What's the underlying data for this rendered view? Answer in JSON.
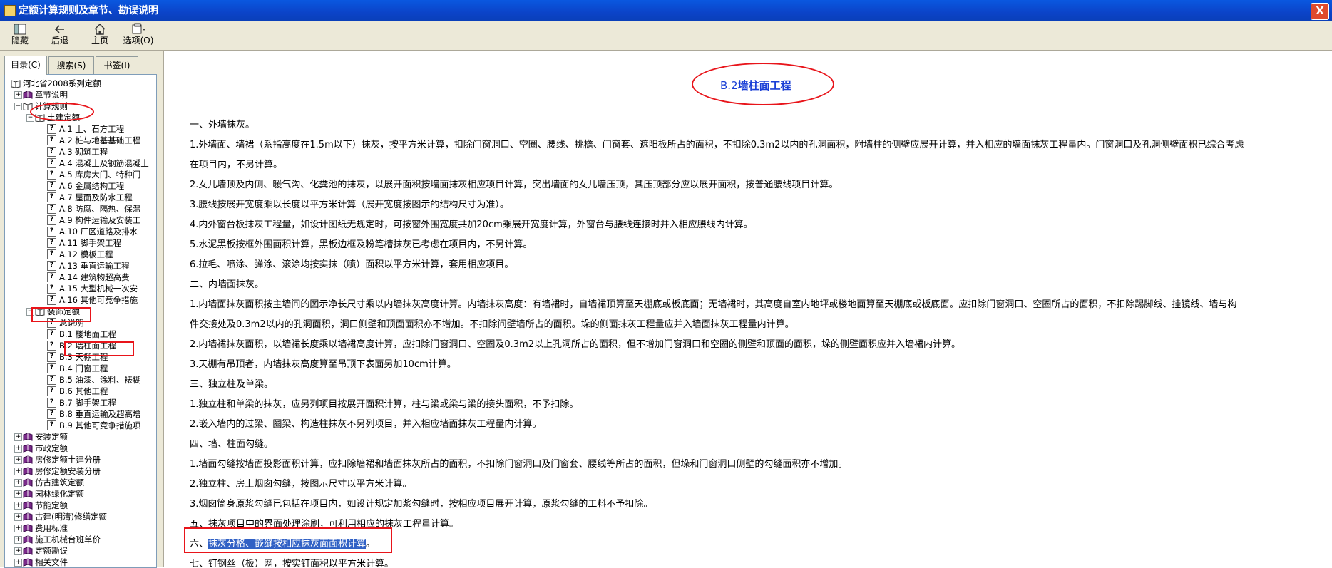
{
  "window": {
    "title": "定额计算规则及章节、勘误说明",
    "close_label": "X"
  },
  "toolbar": {
    "buttons": [
      {
        "label": "隐藏",
        "icon": "hide-icon"
      },
      {
        "label": "后退",
        "icon": "back-arrow-icon"
      },
      {
        "label": "主页",
        "icon": "home-icon"
      },
      {
        "label": "选项(O)",
        "icon": "options-icon"
      }
    ]
  },
  "tabs": [
    {
      "label": "目录(C)"
    },
    {
      "label": "搜索(S)"
    },
    {
      "label": "书签(I)"
    }
  ],
  "tree": [
    "河北省2008系列定额",
    "章节说明",
    "计算规则",
    "土建定额",
    "A.1 土、石方工程",
    "A.2 桩与地基基础工程",
    "A.3 砌筑工程",
    "A.4 混凝土及钢筋混凝土",
    "A.5 库房大门、特种门",
    "A.6 金属结构工程",
    "A.7 屋面及防水工程",
    "A.8 防腐、隔热、保温",
    "A.9 构件运输及安装工",
    "A.10 厂区道路及排水",
    "A.11 脚手架工程",
    "A.12 模板工程",
    "A.13 垂直运输工程",
    "A.14 建筑物超高费",
    "A.15 大型机械一次安",
    "A.16 其他可竞争措施",
    "装饰定额",
    "总说明",
    "B.1 楼地面工程",
    "B.2 墙柱面工程",
    "B.3 天棚工程",
    "B.4 门窗工程",
    "B.5 油漆、涂料、裱糊",
    "B.6 其他工程",
    "B.7 脚手架工程",
    "B.8 垂直运输及超高增",
    "B.9 其他可竞争措施项",
    "安装定额",
    "市政定额",
    "房修定额土建分册",
    "房修定额安装分册",
    "仿古建筑定额",
    "园林绿化定额",
    "节能定额",
    "古建(明清)修缮定额",
    "费用标准",
    "施工机械台班单价",
    "定额勘误",
    "相关文件"
  ],
  "content": {
    "heading": "B.2墙柱面工程",
    "heading_prefix": "B.2",
    "heading_suffix": "墙柱面工程",
    "paragraphs": [
      "一、外墙抹灰。",
      "1.外墙面、墙裙（系指高度在1.5m以下）抹灰，按平方米计算，扣除门窗洞口、空圈、腰线、挑檐、门窗套、遮阳板所占的面积，不扣除0.3m2以内的孔洞面积，附墙柱的侧壁应展开计算，并入相应的墙面抹灰工程量内。门窗洞口及孔洞侧壁面积已综合考虑",
      "在项目内，不另计算。",
      "2.女儿墙顶及内侧、暖气沟、化粪池的抹灰，以展开面积按墙面抹灰相应项目计算，突出墙面的女儿墙压顶，其压顶部分应以展开面积，按普通腰线项目计算。",
      "3.腰线按展开宽度乘以长度以平方米计算（展开宽度按图示的结构尺寸为准）。",
      "4.内外窗台板抹灰工程量，如设计图纸无规定时，可按窗外围宽度共加20cm乘展开宽度计算，外窗台与腰线连接时并入相应腰线内计算。",
      "5.水泥黑板按框外围面积计算，黑板边框及粉笔槽抹灰已考虑在项目内，不另计算。",
      "6.拉毛、喷涂、弹涂、滚涂均按实抹（喷）面积以平方米计算，套用相应项目。",
      "二、内墙面抹灰。",
      "1.内墙面抹灰面积按主墙间的图示净长尺寸乘以内墙抹灰高度计算。内墙抹灰高度：有墙裙时，自墙裙顶算至天棚底或板底面；无墙裙时，其高度自室内地坪或楼地面算至天棚底或板底面。应扣除门窗洞口、空圈所占的面积，不扣除踢脚线、挂镜线、墙与构",
      "件交接处及0.3m2以内的孔洞面积，洞口侧壁和顶面面积亦不增加。不扣除间壁墙所占的面积。垛的侧面抹灰工程量应并入墙面抹灰工程量内计算。",
      "2.内墙裙抹灰面积，以墙裙长度乘以墙裙高度计算，应扣除门窗洞口、空圈及0.3m2以上孔洞所占的面积，但不增加门窗洞口和空圈的侧壁和顶面的面积，垛的侧壁面积应并入墙裙内计算。",
      "3.天棚有吊顶者，内墙抹灰高度算至吊顶下表面另加10cm计算。",
      "三、独立柱及单梁。",
      "1.独立柱和单梁的抹灰，应另列项目按展开面积计算，柱与梁或梁与梁的接头面积，不予扣除。",
      "2.嵌入墙内的过梁、圈梁、构造柱抹灰不另列项目，并入相应墙面抹灰工程量内计算。",
      "四、墙、柱面勾缝。",
      "1.墙面勾缝按墙面投影面积计算，应扣除墙裙和墙面抹灰所占的面积，不扣除门窗洞口及门窗套、腰线等所占的面积，但垛和门窗洞口侧壁的勾缝面积亦不增加。",
      "2.独立柱、房上烟囱勾缝，按图示尺寸以平方米计算。",
      "3.烟囱筒身原浆勾缝已包括在项目内，如设计规定加浆勾缝时，按相应项目展开计算，原浆勾缝的工料不予扣除。",
      "五、抹灰项目中的界面处理涂刷，可利用相应的抹灰工程量计算。",
      "六、抹灰分格、嵌缝按相应抹灰面面积计算。",
      "七、钉钢丝（板）网，按实钉面积以平方米计算。"
    ],
    "p6_prefix": "六、",
    "p6_highlight": "抹灰分格、嵌缝按相应抹灰面面积计算",
    "p6_suffix": "。"
  },
  "colors": {
    "title_bar": "#0b43c8",
    "heading": "#1a3fd6",
    "annotation": "#e8141a",
    "selection": "#3161c5"
  }
}
